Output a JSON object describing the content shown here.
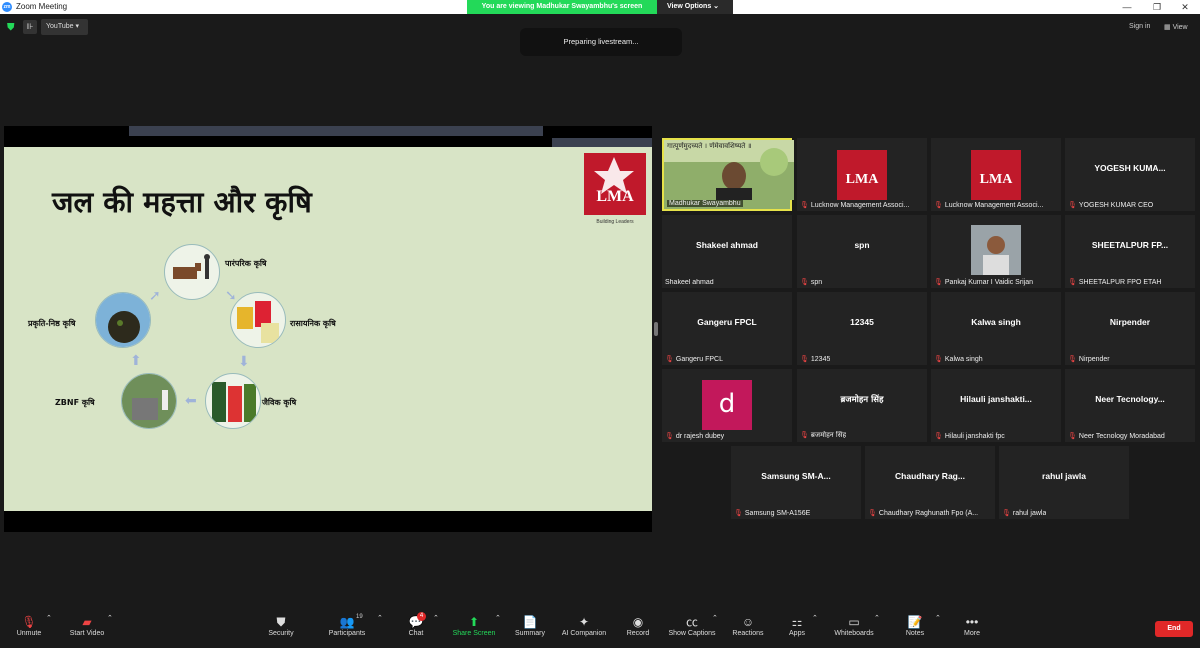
{
  "window": {
    "title": "Zoom Meeting",
    "logo": "zm"
  },
  "banner": {
    "message": "You are viewing Madhukar Swayambhu's screen",
    "view_options": "View Options"
  },
  "topbar": {
    "youtube_label": "YouTube",
    "sign_in": "Sign in",
    "view": "View"
  },
  "livestream": {
    "status": "Preparing livestream..."
  },
  "slide": {
    "title": "जल की महत्ता और कृषि",
    "logo_text": "LMA",
    "logo_tagline": "Building Leaders",
    "cycle": [
      {
        "label": "पारंपरिक कृषि"
      },
      {
        "label": "रासायनिक कृषि"
      },
      {
        "label": "जैविक कृषि"
      },
      {
        "label": "ZBNF कृषि"
      },
      {
        "label": "प्रकृति-निष्ठ कृषि"
      }
    ]
  },
  "tiles": [
    {
      "name": "",
      "label": "Madhukar Swayambhu",
      "type": "video",
      "overlay": "गात्पूर्णमुदच्यते । र्णमेवावशिष्यते ॥"
    },
    {
      "name": "",
      "label": "Lucknow Management Associ...",
      "type": "lma",
      "logo_text": "LMA"
    },
    {
      "name": "",
      "label": "Lucknow Management Associ...",
      "type": "lma",
      "logo_text": "LMA"
    },
    {
      "name": "YOGESH KUMA...",
      "label": "YOGESH KUMAR CEO",
      "type": "name"
    },
    {
      "name": "Shakeel ahmad",
      "label": "Shakeel ahmad",
      "type": "name"
    },
    {
      "name": "spn",
      "label": "spn",
      "type": "name"
    },
    {
      "name": "",
      "label": "Pankaj Kumar I Vaidic Srijan",
      "type": "photo"
    },
    {
      "name": "SHEETALPUR FP...",
      "label": "SHEETALPUR FPO ETAH",
      "type": "name"
    },
    {
      "name": "Gangeru FPCL",
      "label": "Gangeru FPCL",
      "type": "name"
    },
    {
      "name": "12345",
      "label": "12345",
      "type": "name"
    },
    {
      "name": "Kalwa singh",
      "label": "Kalwa singh",
      "type": "name"
    },
    {
      "name": "Nirpender",
      "label": "Nirpender",
      "type": "name"
    },
    {
      "name": "",
      "label": "dr rajesh dubey",
      "type": "avatar",
      "avatar_letter": "d"
    },
    {
      "name": "ब्रजमोहन सिंह",
      "label": "ब्रजमोहन सिंह",
      "type": "name"
    },
    {
      "name": "Hilauli janshakti...",
      "label": "Hilauli janshakti fpc",
      "type": "name"
    },
    {
      "name": "Neer Tecnology...",
      "label": "Neer Tecnology Moradabad",
      "type": "name"
    },
    {
      "name": "Samsung SM-A...",
      "label": "Samsung SM-A156E",
      "type": "name"
    },
    {
      "name": "Chaudhary Rag...",
      "label": "Chaudhary Raghunath Fpo (A...",
      "type": "name"
    },
    {
      "name": "rahul jawla",
      "label": "rahul jawla",
      "type": "name"
    }
  ],
  "toolbar": {
    "unmute": "Unmute",
    "start_video": "Start Video",
    "security": "Security",
    "participants": "Participants",
    "participants_count": "19",
    "chat": "Chat",
    "chat_badge": "4",
    "share_screen": "Share Screen",
    "summary": "Summary",
    "ai_companion": "AI Companion",
    "record": "Record",
    "show_captions": "Show Captions",
    "reactions": "Reactions",
    "apps": "Apps",
    "whiteboards": "Whiteboards",
    "notes": "Notes",
    "more": "More",
    "end": "End"
  },
  "colors": {
    "share_green": "#23d959",
    "end_red": "#e02828",
    "active_border": "#e6e24a",
    "avatar_pink": "#c2185b",
    "slide_bg": "#d8e4c6"
  }
}
